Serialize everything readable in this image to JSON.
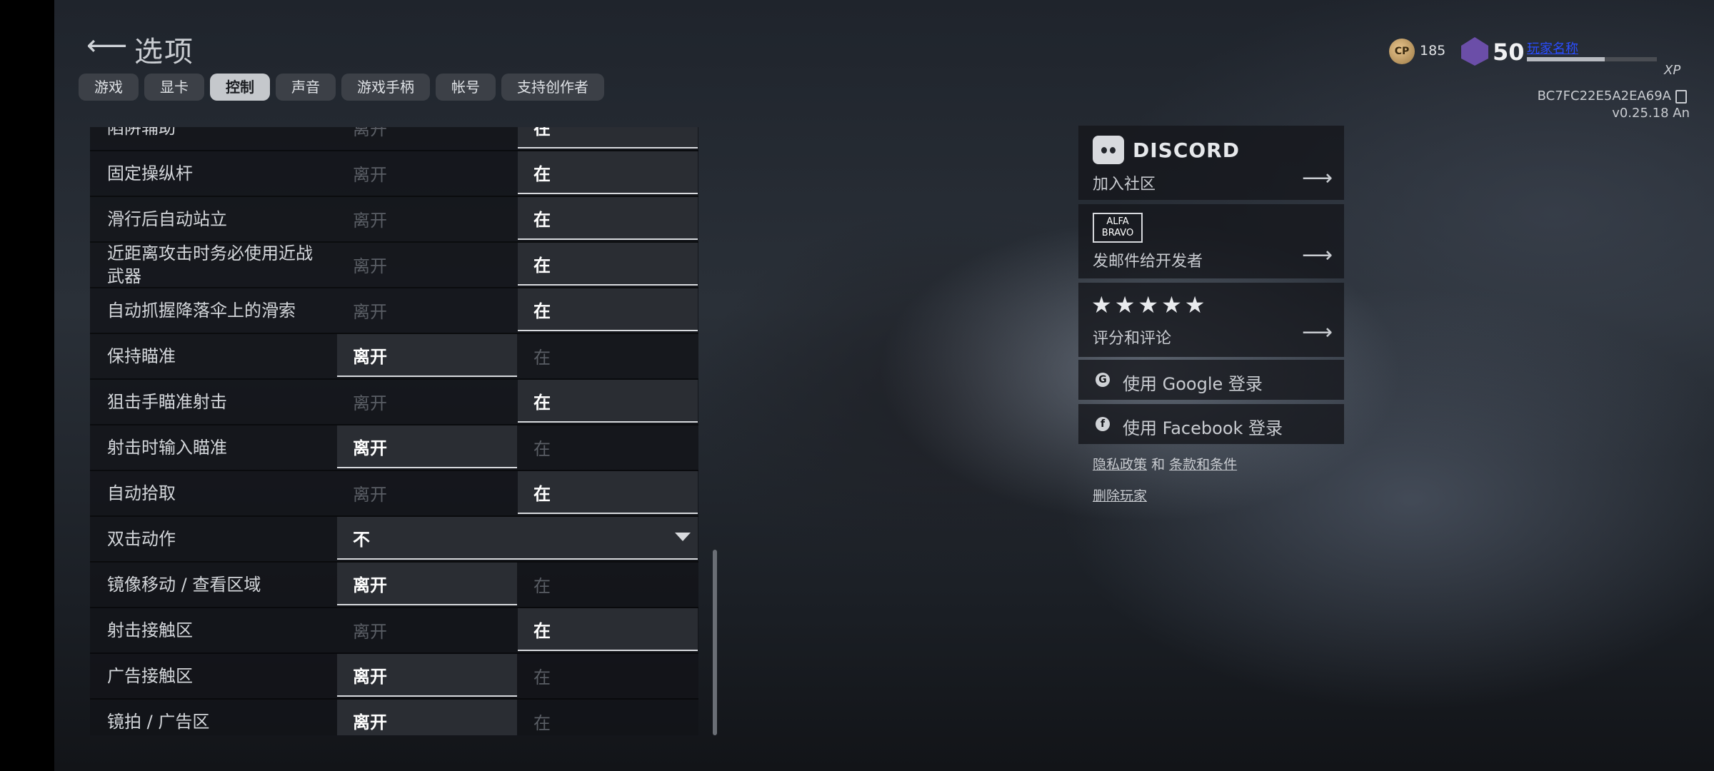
{
  "header": {
    "back_icon": "arrow-left-icon",
    "title": "选项"
  },
  "tabs": [
    {
      "label": "游戏",
      "active": false
    },
    {
      "label": "显卡",
      "active": false
    },
    {
      "label": "控制",
      "active": true
    },
    {
      "label": "声音",
      "active": false
    },
    {
      "label": "游戏手柄",
      "active": false
    },
    {
      "label": "帐号",
      "active": false
    },
    {
      "label": "支持创作者",
      "active": false
    }
  ],
  "settings": {
    "off_label": "离开",
    "on_label": "在",
    "rows": [
      {
        "label": "陷阱辅助",
        "value": "on"
      },
      {
        "label": "固定操纵杆",
        "value": "on"
      },
      {
        "label": "滑行后自动站立",
        "value": "on"
      },
      {
        "label": "近距离攻击时务必使用近战武器",
        "value": "on"
      },
      {
        "label": "自动抓握降落伞上的滑索",
        "value": "on"
      },
      {
        "label": "保持瞄准",
        "value": "off"
      },
      {
        "label": "狙击手瞄准射击",
        "value": "on"
      },
      {
        "label": "射击时输入瞄准",
        "value": "off"
      },
      {
        "label": "自动拾取",
        "value": "on"
      },
      {
        "label": "双击动作",
        "type": "dropdown",
        "value": "不"
      },
      {
        "label": "镜像移动 / 查看区域",
        "value": "off"
      },
      {
        "label": "射击接触区",
        "value": "on"
      },
      {
        "label": "广告接触区",
        "value": "off"
      },
      {
        "label": "镜拍 / 广告区",
        "value": "off"
      }
    ]
  },
  "community": {
    "discord": {
      "brand": "DISCORD",
      "text": "加入社区",
      "icon": "discord-icon"
    },
    "developer": {
      "logo_top": "ALFA",
      "logo_bottom": "BRAVO",
      "text": "发邮件给开发者"
    },
    "rating": {
      "stars": "★★★★★",
      "text": "评分和评论"
    },
    "google_login": "使用 Google 登录",
    "facebook_login": "使用 Facebook 登录",
    "privacy": "隐私政策",
    "and": "和",
    "terms": "条款和条件",
    "delete_player": "删除玩家"
  },
  "status": {
    "cp_label": "CP",
    "cp_value": "185",
    "level": "50",
    "player_name": "玩家名称",
    "xp_fraction": 0.6,
    "xp_label": "XP",
    "player_id": "BC7FC22E5A2EA69A",
    "version": "v0.25.18 An"
  },
  "colors": {
    "selected_bg": "#2a2d33",
    "active_tab_bg": "#c5c8cc",
    "tab_bg": "#3c4047",
    "link_blue": "#2a4dff"
  }
}
